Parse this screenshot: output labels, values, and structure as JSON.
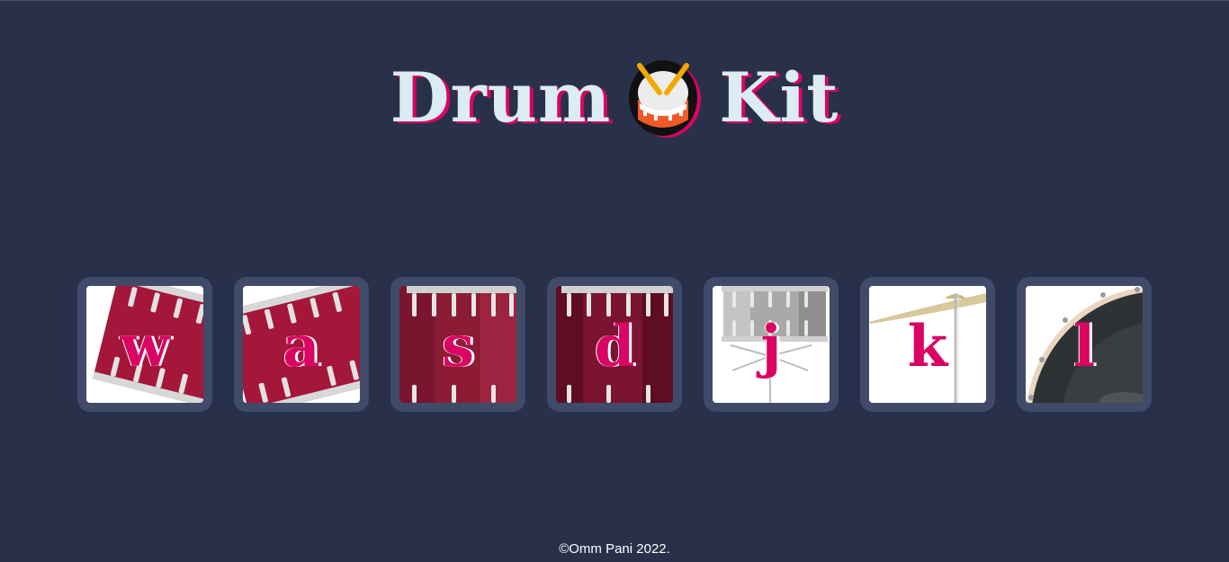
{
  "header": {
    "title_left": "Drum",
    "title_icon": "drum-emoji-icon",
    "title_right": "Kit"
  },
  "drums": [
    {
      "key": "w",
      "image": "tom-1"
    },
    {
      "key": "a",
      "image": "tom-2"
    },
    {
      "key": "s",
      "image": "tom-3"
    },
    {
      "key": "d",
      "image": "tom-4"
    },
    {
      "key": "j",
      "image": "snare"
    },
    {
      "key": "k",
      "image": "crash"
    },
    {
      "key": "l",
      "image": "kick-bass"
    }
  ],
  "footer": {
    "text": "©Omm Pani 2022."
  },
  "colors": {
    "background": "#283149",
    "button_frame": "#404b69",
    "title_text": "#dbedf3",
    "accent": "#da0463"
  }
}
